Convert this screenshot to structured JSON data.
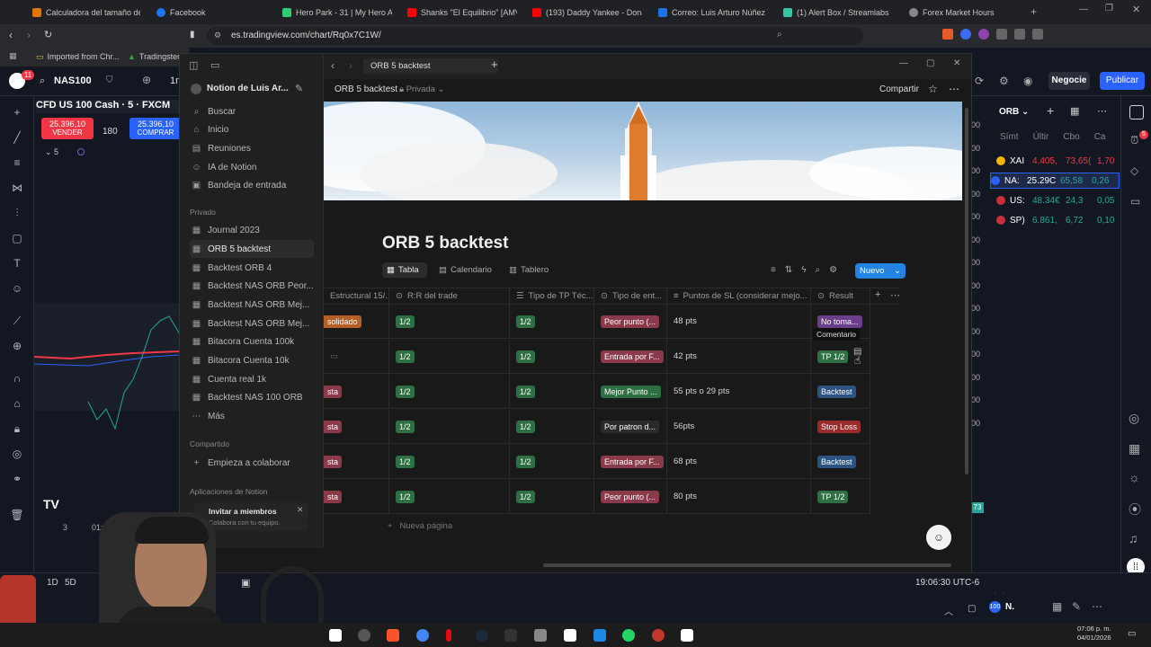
{
  "browser": {
    "tabs": [
      {
        "label": "Calculadora del tamaño de p",
        "color": "#e37400"
      },
      {
        "label": "Facebook",
        "color": "#1877f2"
      },
      {
        "label": "Hero Park - 31 | My Hero Aca",
        "color": "#2ecc71"
      },
      {
        "label": "Shanks \"El Equilibrio\" [AMV] (",
        "color": "#ff0000"
      },
      {
        "label": "(193) Daddy Yankee - Donante",
        "color": "#ff0000"
      },
      {
        "label": "Correo: Luis Arturo Núñez Tol",
        "color": "#1a73e8"
      },
      {
        "label": "(1) Alert Box / Streamlabs",
        "color": "#31c3a2"
      },
      {
        "label": "Forex Market Hours",
        "color": "#888888"
      }
    ],
    "url": "es.tradingview.com/chart/Rq0x7C1W/",
    "bookmarks": [
      "Imported from Chr...",
      "Tradingster.c"
    ]
  },
  "tradingview": {
    "symbol": "NAS100",
    "interval": "1n",
    "instrument_title": "CFD US 100 Cash · 5 · FXCM",
    "sell_price": "25.396,10",
    "sell_label": "VENDER",
    "spread": "180",
    "buy_price": "25.396,10",
    "buy_label": "COMPRAR",
    "count": "5",
    "right_axis_labels": [
      "00",
      "00",
      "00",
      "00",
      "00",
      "00",
      "00",
      "00",
      "00",
      "00",
      "00",
      "00",
      "00",
      "00"
    ],
    "bottom_label": "3",
    "bottom_time": "01:",
    "timeframes": [
      "1D",
      "5D"
    ],
    "clock": "19:06:30 UTC-6",
    "negocie": "Negocie",
    "publicar": "Publicar",
    "notif_count": "11",
    "right_badge": "5",
    "bottom_badge": "73",
    "bottom_right_label": "N.",
    "watchlist": {
      "title": "ORB",
      "headers": [
        "Símt",
        "Últir",
        "Cbo",
        "Ca"
      ],
      "rows": [
        {
          "sym": "XAI",
          "last": "4.405,",
          "chg": "73,65(",
          "pct": "1,70",
          "color": "#f5b400",
          "chgcolor": "#f23645"
        },
        {
          "sym": "NA:",
          "last": "25.29C",
          "chg": "65,58",
          "pct": "0,26",
          "color": "#2962ff",
          "chgcolor": "#26a69a"
        },
        {
          "sym": "US:",
          "last": "48.34€",
          "chg": "24,3",
          "pct": "0,05",
          "color": "#cc2f3c",
          "chgcolor": "#26a69a"
        },
        {
          "sym": "SP)",
          "last": "6.861,",
          "chg": "6,72",
          "pct": "0,10",
          "color": "#cc2f3c",
          "chgcolor": "#26a69a"
        }
      ]
    }
  },
  "notion": {
    "workspace": "Notion de Luis Ar...",
    "breadcrumb": "ORB 5 backtest",
    "privacy": "Privada",
    "share": "Compartir",
    "nav": [
      {
        "label": "Buscar",
        "icon": "search-icon"
      },
      {
        "label": "Inicio",
        "icon": "home-icon"
      },
      {
        "label": "Reuniones",
        "icon": "meetings-icon"
      },
      {
        "label": "IA de Notion",
        "icon": "ai-icon"
      },
      {
        "label": "Bandeja de entrada",
        "icon": "inbox-icon"
      }
    ],
    "private_label": "Privado",
    "pages": [
      "Journal 2023",
      "ORB 5 backtest",
      "Backtest ORB 4",
      "Backtest NAS ORB Peor...",
      "Backtest NAS ORB Mej...",
      "Backtest NAS ORB Mej...",
      "Bitacora Cuenta 100k",
      "Bitacora Cuenta 10k",
      "Cuenta real 1k",
      "Backtest NAS 100 ORB"
    ],
    "more": "Más",
    "shared_label": "Compartido",
    "shared_item": "Empieza a colaborar",
    "apps_label": "Aplicaciones de Notion",
    "invite_title": "Invitar a miembros",
    "invite_sub": "Colabora con tu equipo.",
    "title": "ORB 5 backtest",
    "views": [
      "Tabla",
      "Calendario",
      "Tablero"
    ],
    "new_button": "Nuevo",
    "columns": [
      "Estructural 15/...",
      "R:R del trade",
      "Tipo de TP Téc...",
      "Tipo de ent...",
      "Puntos de SL (considerar mejo...",
      "Result"
    ],
    "rows": [
      {
        "c0": "solidado",
        "c1": "1/2",
        "c2": "1/2",
        "c3": "Peor punto (...",
        "c4": "48 pts",
        "c5": "No toma..."
      },
      {
        "c0": "",
        "c1": "1/2",
        "c2": "1/2",
        "c3": "Entrada por F...",
        "c4": "42 pts",
        "c5": "TP 1/2"
      },
      {
        "c0": "sta",
        "c1": "1/2",
        "c2": "1/2",
        "c3": "Mejor Punto ...",
        "c4": "55 pts o 29 pts",
        "c5": "Backtest"
      },
      {
        "c0": "sta",
        "c1": "1/2",
        "c2": "1/2",
        "c3": "Por patron d...",
        "c4": "56pts",
        "c5": "Stop Loss"
      },
      {
        "c0": "sta",
        "c1": "1/2",
        "c2": "1/2",
        "c3": "Entrada por F...",
        "c4": "68 pts",
        "c5": "Backtest"
      },
      {
        "c0": "sta",
        "c1": "1/2",
        "c2": "1/2",
        "c3": "Peor punto (...",
        "c4": "80 pts",
        "c5": "TP 1/2"
      }
    ],
    "tooltip": "Comentario",
    "new_page": "Nueva página"
  },
  "taskbar": {
    "time": "07:06 p. m.",
    "date": "04/01/2026"
  }
}
